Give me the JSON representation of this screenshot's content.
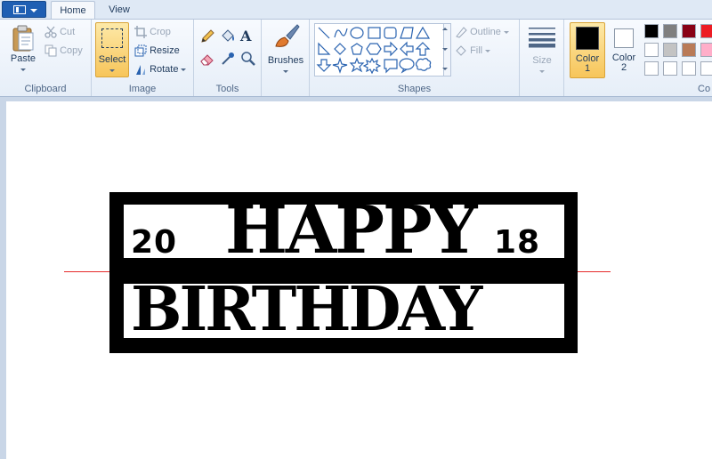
{
  "tabs": [
    {
      "label": "Home",
      "active": true
    },
    {
      "label": "View",
      "active": false
    }
  ],
  "clipboard": {
    "group_label": "Clipboard",
    "paste": "Paste",
    "cut": "Cut",
    "copy": "Copy"
  },
  "image": {
    "group_label": "Image",
    "select": "Select",
    "crop": "Crop",
    "resize": "Resize",
    "rotate": "Rotate"
  },
  "tools": {
    "group_label": "Tools"
  },
  "brushes": {
    "label": "Brushes"
  },
  "shapes": {
    "group_label": "Shapes",
    "outline": "Outline",
    "fill": "Fill"
  },
  "size": {
    "label": "Size"
  },
  "colors": {
    "color1_label": "Color",
    "color1_num": "1",
    "color1_value": "#000000",
    "color2_label": "Color",
    "color2_num": "2",
    "color2_value": "#ffffff",
    "group_label": "Co",
    "palette_row1": [
      "#000000",
      "#7f7f7f",
      "#880015",
      "#ed1c24"
    ],
    "palette_row2": [
      "#ffffff",
      "#c3c3c3",
      "#b97a57",
      "#ffaec9"
    ],
    "palette_row3": [
      "#ffffff",
      "#ffffff",
      "#ffffff",
      "#ffffff"
    ]
  },
  "artwork": {
    "line1": "HAPPY",
    "line2": "BIRTHDAY",
    "year_left": "20",
    "year_right": "18"
  }
}
